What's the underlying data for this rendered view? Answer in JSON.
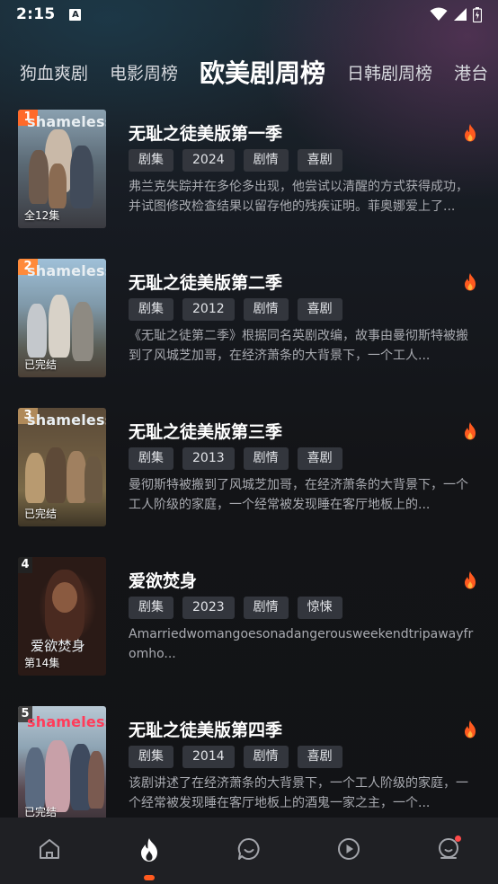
{
  "status_bar": {
    "time": "2:15",
    "notification_icon": "A"
  },
  "tabs": [
    {
      "label": "狗血爽剧",
      "active": false
    },
    {
      "label": "电影周榜",
      "active": false
    },
    {
      "label": "欧美剧周榜",
      "active": true
    },
    {
      "label": "日韩剧周榜",
      "active": false
    },
    {
      "label": "港台",
      "active": false
    }
  ],
  "items": [
    {
      "rank": "1",
      "poster_logo": "shameless",
      "poster_status": "全12集",
      "title": "无耻之徒美版第一季",
      "tags": [
        "剧集",
        "2024",
        "剧情",
        "喜剧"
      ],
      "desc": "弗兰克失踪并在多伦多出现，他尝试以清醒的方式获得成功，并试图修改检查结果以留存他的残疾证明。菲奥娜爱上了..."
    },
    {
      "rank": "2",
      "poster_logo": "shameless",
      "poster_status": "已完结",
      "title": "无耻之徒美版第二季",
      "tags": [
        "剧集",
        "2012",
        "剧情",
        "喜剧"
      ],
      "desc": "《无耻之徒第二季》根据同名英剧改编，故事由曼彻斯特被搬到了风城芝加哥，在经济萧条的大背景下，一个工人..."
    },
    {
      "rank": "3",
      "poster_logo": "shameless",
      "poster_status": "已完结",
      "title": "无耻之徒美版第三季",
      "tags": [
        "剧集",
        "2013",
        "剧情",
        "喜剧"
      ],
      "desc": "曼彻斯特被搬到了风城芝加哥，在经济萧条的大背景下，一个工人阶级的家庭，一个经常被发现睡在客厅地板上的..."
    },
    {
      "rank": "4",
      "poster_logo": "爱欲焚身",
      "poster_status": "第14集",
      "title": "爱欲焚身",
      "tags": [
        "剧集",
        "2023",
        "剧情",
        "惊悚"
      ],
      "desc": "Amarriedwomangoesonadangerousweekendtripawayfromho..."
    },
    {
      "rank": "5",
      "poster_logo": "shameless",
      "poster_status": "已完结",
      "title": "无耻之徒美版第四季",
      "tags": [
        "剧集",
        "2014",
        "剧情",
        "喜剧"
      ],
      "desc": "该剧讲述了在经济萧条的大背景下，一个工人阶级的家庭，一个经常被发现睡在客厅地板上的酒鬼一家之主，一个..."
    }
  ],
  "bottom_nav": [
    {
      "name": "home-icon",
      "active": false
    },
    {
      "name": "fire-icon",
      "active": true
    },
    {
      "name": "chat-icon",
      "active": false
    },
    {
      "name": "play-icon",
      "active": false
    },
    {
      "name": "profile-icon",
      "active": false,
      "badge": true
    }
  ],
  "colors": {
    "accent": "#ff5a1f",
    "rank1": "#ff6a2a",
    "rank2": "#ff8a3a",
    "rank3": "#b08a5a",
    "tag_bg": "#33363d"
  }
}
